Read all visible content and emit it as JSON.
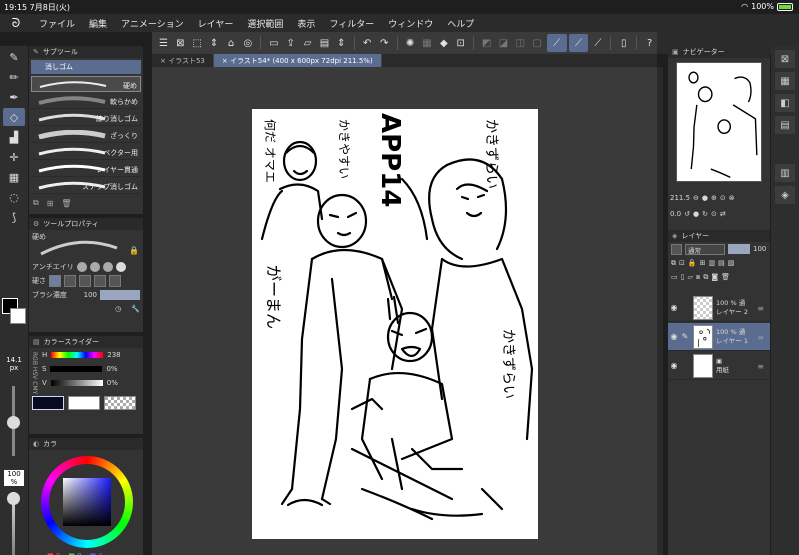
{
  "status": {
    "time": "19:15",
    "date": "7月8日(火)",
    "battery": "100%",
    "wifi_icon": "wifi-icon"
  },
  "menu": [
    "ファイル",
    "編集",
    "アニメーション",
    "レイヤー",
    "選択範囲",
    "表示",
    "フィルター",
    "ウィンドウ",
    "ヘルプ"
  ],
  "tabs": [
    {
      "label": "× イラスト53"
    },
    {
      "label": "× イラスト54* (400 x 600px 72dpi 211.5%)"
    }
  ],
  "subtool": {
    "title": "サブツール",
    "category": "消しゴム",
    "brushes": [
      "硬め",
      "軟らかめ",
      "練り消しゴム",
      "ざっくり",
      "ベクター用",
      "レイヤー貫通",
      "スナップ消しゴム"
    ]
  },
  "toolprop": {
    "title": "ツールプロパティ",
    "preset": "硬め",
    "antialias_label": "アンチエイリ",
    "hardness_label": "硬さ",
    "density_label": "ブラシ濃度",
    "density_value": "100",
    "density_fraction": 1.0
  },
  "brush_size": {
    "value": "14.1",
    "unit": "px"
  },
  "opacity": {
    "value": "100",
    "unit": "%"
  },
  "color_slider": {
    "title": "カラースライダー",
    "h_label": "H",
    "h_value": "238",
    "s_label": "S",
    "s_value": "0%",
    "v_label": "V",
    "v_value": "0%",
    "tabs": [
      "RGB",
      "HSV",
      "CMY"
    ]
  },
  "color_wheel": {
    "title": "カラ",
    "r": "0",
    "g": "0",
    "b": "0"
  },
  "navigator": {
    "title": "ナビゲーター",
    "zoom": "211.5",
    "rotation": "0.0"
  },
  "layers": {
    "title": "レイヤー",
    "blend": "通常",
    "opacity": "100",
    "items": [
      {
        "pct": "100 % 通",
        "name": "レイヤー 2",
        "selected": false
      },
      {
        "pct": "100 % 通",
        "name": "レイヤー 1",
        "selected": true
      },
      {
        "pct": "",
        "name": "用紙",
        "selected": false
      }
    ]
  },
  "drawing_text": [
    "APP14",
    "かきずらい",
    "何だ オマエ",
    "かきやすい",
    "がーまん",
    "かきずらい"
  ],
  "colors": {
    "accent": "#5a6c90",
    "panel": "#333333",
    "bg": "#1e1e1e"
  }
}
